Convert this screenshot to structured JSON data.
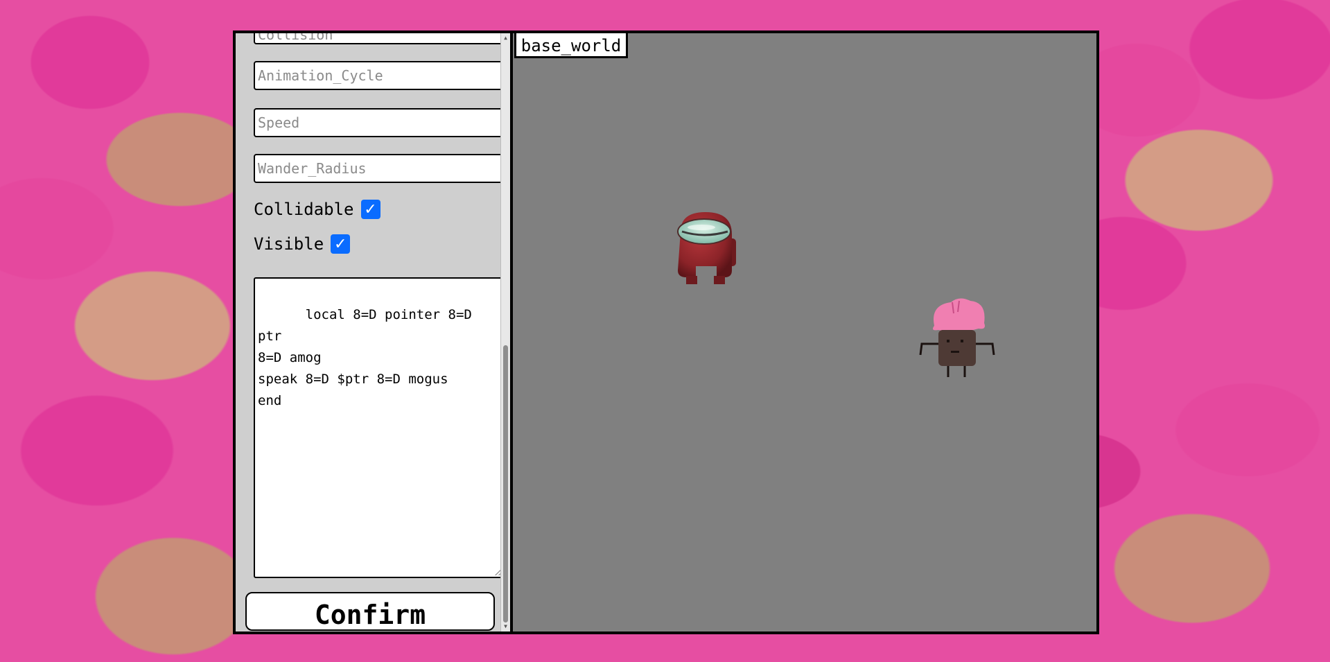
{
  "editor": {
    "cut_field": {
      "placeholder": "Collision"
    },
    "animation_cycle": {
      "placeholder": "Animation_Cycle"
    },
    "speed": {
      "placeholder": "Speed"
    },
    "wander_radius": {
      "placeholder": "Wander_Radius"
    },
    "collidable": {
      "label": "Collidable",
      "checked": true,
      "mark": "✓"
    },
    "visible": {
      "label": "Visible",
      "checked": true,
      "mark": "✓"
    },
    "script": "local 8=D pointer 8=D ptr\n8=D amog\nspeak 8=D $ptr 8=D mogus\nend",
    "confirm_label": "Confirm"
  },
  "world": {
    "tab_label": "base_world",
    "sprites": [
      {
        "name": "amogus-sprite",
        "color": "#8b2328"
      },
      {
        "name": "pink-hair-npc-sprite",
        "color": "#4e3a35"
      }
    ]
  },
  "colors": {
    "world_bg": "#808080",
    "panel_bg": "#cfcfcf",
    "checkbox_accent": "#0a6cff"
  }
}
